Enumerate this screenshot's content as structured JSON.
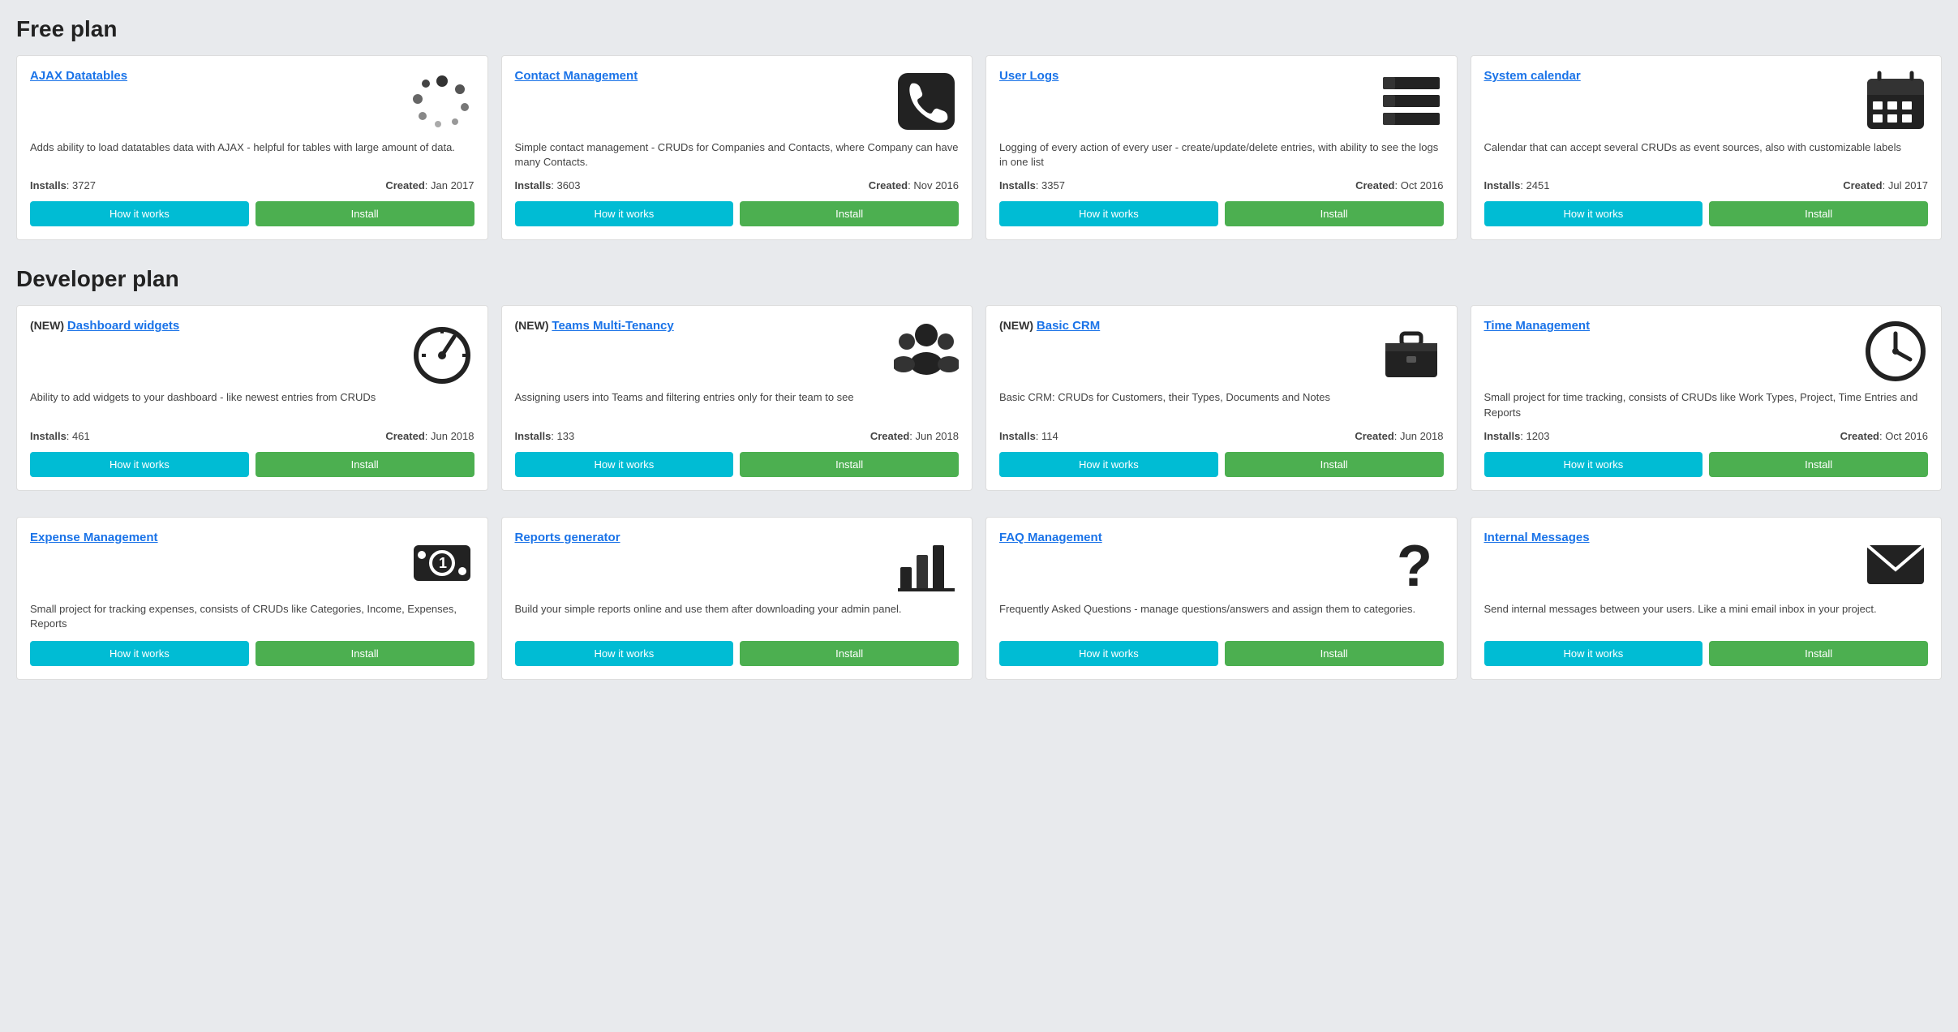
{
  "sections": [
    {
      "title": "Free plan",
      "cards": [
        {
          "id": "ajax-datatables",
          "new": false,
          "title": "AJAX Datatables",
          "description": "Adds ability to load datatables data with AJAX - helpful for tables with large amount of data.",
          "installs": "3727",
          "created": "Jan 2017",
          "icon": "ajax",
          "how_label": "How it works",
          "install_label": "Install"
        },
        {
          "id": "contact-management",
          "new": false,
          "title": "Contact Management",
          "description": "Simple contact management - CRUDs for Companies and Contacts, where Company can have many Contacts.",
          "installs": "3603",
          "created": "Nov 2016",
          "icon": "phone",
          "how_label": "How it works",
          "install_label": "Install"
        },
        {
          "id": "user-logs",
          "new": false,
          "title": "User Logs",
          "description": "Logging of every action of every user - create/update/delete entries, with ability to see the logs in one list",
          "installs": "3357",
          "created": "Oct 2016",
          "icon": "logs",
          "how_label": "How it works",
          "install_label": "Install"
        },
        {
          "id": "system-calendar",
          "new": false,
          "title": "System calendar",
          "description": "Calendar that can accept several CRUDs as event sources, also with customizable labels",
          "installs": "2451",
          "created": "Jul 2017",
          "icon": "calendar",
          "how_label": "How it works",
          "install_label": "Install"
        }
      ]
    },
    {
      "title": "Developer plan",
      "cards": [
        {
          "id": "dashboard-widgets",
          "new": true,
          "title": "Dashboard widgets",
          "description": "Ability to add widgets to your dashboard - like newest entries from CRUDs",
          "installs": "461",
          "created": "Jun 2018",
          "icon": "dashboard",
          "how_label": "How it works",
          "install_label": "Install"
        },
        {
          "id": "teams-multi-tenancy",
          "new": true,
          "title": "Teams Multi-Tenancy",
          "description": "Assigning users into Teams and filtering entries only for their team to see",
          "installs": "133",
          "created": "Jun 2018",
          "icon": "team",
          "how_label": "How it works",
          "install_label": "Install"
        },
        {
          "id": "basic-crm",
          "new": true,
          "title": "Basic CRM",
          "description": "Basic CRM: CRUDs for Customers, their Types, Documents and Notes",
          "installs": "114",
          "created": "Jun 2018",
          "icon": "briefcase",
          "how_label": "How it works",
          "install_label": "Install"
        },
        {
          "id": "time-management",
          "new": false,
          "title": "Time Management",
          "description": "Small project for time tracking, consists of CRUDs like Work Types, Project, Time Entries and Reports",
          "installs": "1203",
          "created": "Oct 2016",
          "icon": "clock",
          "how_label": "How it works",
          "install_label": "Install"
        }
      ]
    },
    {
      "title": "",
      "cards": [
        {
          "id": "expense-management",
          "new": false,
          "title": "Expense Management",
          "description": "Small project for tracking expenses, consists of CRUDs like Categories, Income, Expenses, Reports",
          "installs": "",
          "created": "",
          "icon": "money",
          "how_label": "How it works",
          "install_label": "Install"
        },
        {
          "id": "reports-generator",
          "new": false,
          "title": "Reports generator",
          "description": "Build your simple reports online and use them after downloading your admin panel.",
          "installs": "",
          "created": "",
          "icon": "chart",
          "how_label": "How it works",
          "install_label": "Install"
        },
        {
          "id": "faq-management",
          "new": false,
          "title": "FAQ Management",
          "description": "Frequently Asked Questions - manage questions/answers and assign them to categories.",
          "installs": "",
          "created": "",
          "icon": "question",
          "how_label": "How it works",
          "install_label": "Install"
        },
        {
          "id": "internal-messages",
          "new": false,
          "title": "Internal Messages",
          "description": "Send internal messages between your users. Like a mini email inbox in your project.",
          "installs": "",
          "created": "",
          "icon": "envelope",
          "how_label": "How it works",
          "install_label": "Install"
        }
      ]
    }
  ],
  "installs_label": "Installs",
  "created_label": "Created"
}
